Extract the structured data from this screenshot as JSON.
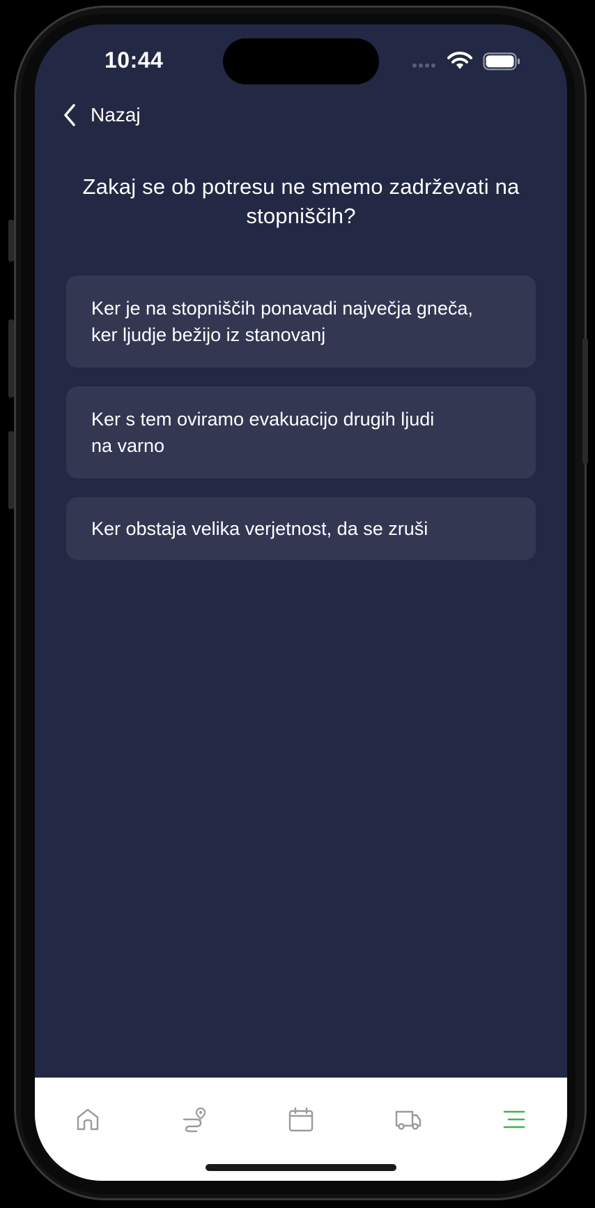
{
  "status_bar": {
    "time": "10:44"
  },
  "nav": {
    "back_label": "Nazaj"
  },
  "quiz": {
    "question": "Zakaj se ob potresu ne smemo zadrževati na stopniščih?",
    "answers": [
      {
        "text": "Ker je na stopniščih ponavadi največja gneča,\nker ljudje bežijo iz stanovanj"
      },
      {
        "text": "Ker s tem oviramo evakuacijo drugih ljudi\nna varno"
      },
      {
        "text": "Ker obstaja velika verjetnost, da se zruši"
      }
    ]
  },
  "tab_bar": {
    "tabs": [
      {
        "icon": "home-icon",
        "active": false
      },
      {
        "icon": "route-icon",
        "active": false
      },
      {
        "icon": "calendar-icon",
        "active": false
      },
      {
        "icon": "truck-icon",
        "active": false
      },
      {
        "icon": "menu-icon",
        "active": true
      }
    ]
  },
  "colors": {
    "background": "#232844",
    "card": "#333752",
    "text": "#ffffff",
    "tab_inactive": "#9a9a9a",
    "tab_active": "#3bb54a"
  }
}
